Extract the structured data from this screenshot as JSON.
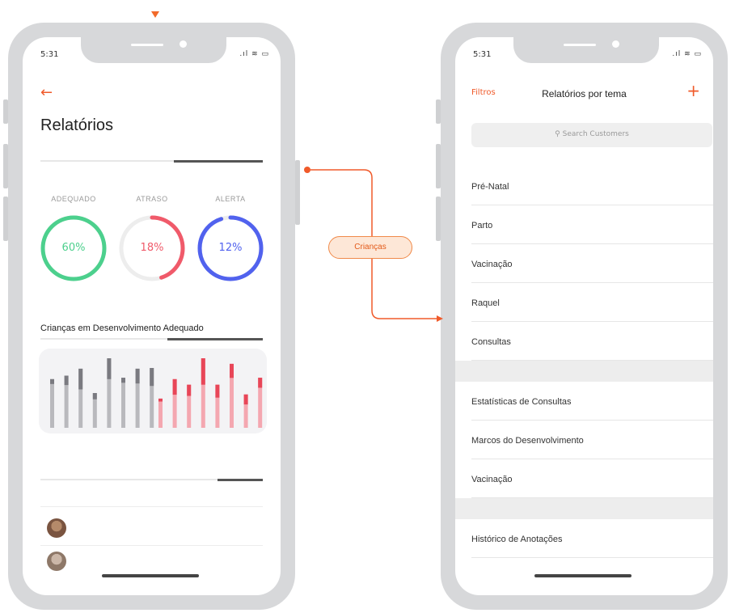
{
  "left_screen": {
    "status_time": "5:31",
    "title": "Relatórios",
    "stats": [
      {
        "label": "ADEQUADO",
        "value": "60%",
        "percent": 1.0,
        "color": "#4cd08d"
      },
      {
        "label": "ATRASO",
        "value": "18%",
        "percent": 0.45,
        "color": "#f05a6a"
      },
      {
        "label": "ALERTA",
        "value": "12%",
        "percent": 0.95,
        "color": "#5162ee"
      }
    ],
    "section_title": "Crianças em Desenvolvimento Adequado",
    "bar_chart": {
      "gray": [
        [
          0.7,
          0.1
        ],
        [
          0.75,
          0.18
        ],
        [
          0.85,
          0.35
        ],
        [
          0.5,
          0.18
        ],
        [
          1.0,
          0.3
        ],
        [
          0.72,
          0.1
        ],
        [
          0.85,
          0.25
        ],
        [
          0.86,
          0.3
        ]
      ],
      "red": [
        [
          0.42,
          0.1
        ],
        [
          0.7,
          0.32
        ],
        [
          0.62,
          0.26
        ],
        [
          1.0,
          0.38
        ],
        [
          0.62,
          0.3
        ],
        [
          0.92,
          0.22
        ],
        [
          0.48,
          0.3
        ],
        [
          0.72,
          0.2
        ]
      ]
    }
  },
  "right_screen": {
    "status_time": "5:31",
    "filters_label": "Filtros",
    "title": "Relatórios por tema",
    "search_placeholder": "Search Customers",
    "group1": [
      "Pré-Natal",
      "Parto",
      "Vacinação",
      "Raquel",
      "Consultas"
    ],
    "group2": [
      "Estatísticas de Consultas",
      "Marcos do Desenvolvimento",
      "Vacinação"
    ],
    "group3": [
      "Histórico de Anotações"
    ]
  },
  "connector_label": "Crianças",
  "icons": {
    "back": "arrow-left-icon",
    "add": "plus-icon",
    "search": "search-icon"
  }
}
